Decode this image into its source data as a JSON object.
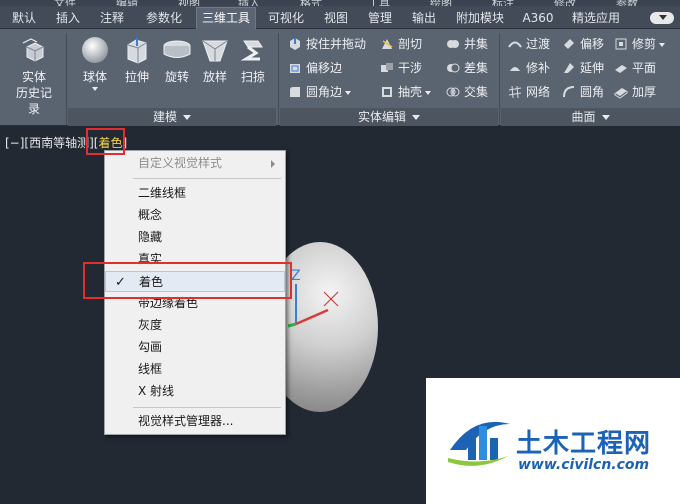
{
  "menu_strip": [
    "文件",
    "编辑",
    "视图",
    "插入",
    "格式",
    "工具",
    "绘图",
    "标注",
    "修改",
    "参数"
  ],
  "tabs": [
    {
      "label": "默认",
      "active": false
    },
    {
      "label": "插入",
      "active": false
    },
    {
      "label": "注释",
      "active": false
    },
    {
      "label": "参数化",
      "active": false
    },
    {
      "label": "三维工具",
      "active": true
    },
    {
      "label": "可视化",
      "active": false
    },
    {
      "label": "视图",
      "active": false
    },
    {
      "label": "管理",
      "active": false
    },
    {
      "label": "输出",
      "active": false
    },
    {
      "label": "附加模块",
      "active": false
    },
    {
      "label": "A360",
      "active": false
    },
    {
      "label": "精选应用",
      "active": false
    }
  ],
  "ribbon": {
    "history": {
      "line1": "实体",
      "line2": "历史记录"
    },
    "modeling": {
      "title": "建模",
      "buttons": [
        "球体",
        "拉伸",
        "旋转",
        "放样",
        "扫掠"
      ]
    },
    "solid_editing": {
      "title": "实体编辑",
      "buttons": [
        "按住并拖动",
        "偏移边",
        "圆角边",
        "剖切",
        "干涉",
        "抽壳",
        "并集",
        "差集",
        "交集"
      ]
    },
    "surface": {
      "title": "曲面",
      "buttons": [
        "过渡",
        "修补",
        "网络",
        "偏移",
        "延伸",
        "圆角",
        "修剪",
        "平面",
        "加厚"
      ]
    }
  },
  "viewport": {
    "label_prefix": "[−][西南等轴测]",
    "label_open": "[",
    "visual_style": "着色",
    "label_close": "]",
    "axis_z": "Z"
  },
  "context_menu": {
    "items": [
      {
        "label": "自定义视觉样式",
        "disabled": true,
        "submenu": true
      },
      {
        "label": "二维线框"
      },
      {
        "label": "概念"
      },
      {
        "label": "隐藏"
      },
      {
        "label": "真实"
      },
      {
        "label": "着色",
        "checked": true
      },
      {
        "label": "带边缘着色"
      },
      {
        "label": "灰度"
      },
      {
        "label": "勾画"
      },
      {
        "label": "线框"
      },
      {
        "label": "X 射线"
      },
      {
        "label": "视觉样式管理器..."
      }
    ],
    "check_mark": "✓"
  },
  "watermark": {
    "title": "土木工程网",
    "url": "www.civilcn.com"
  },
  "colors": {
    "tab_active": "#5a6472",
    "ribbon_bg": "#5a6370",
    "viewport_bg": "#222933",
    "highlight_box": "#e02f2f",
    "visual_style_text": "#f2d34a",
    "watermark_blue": "#1c63b6"
  }
}
